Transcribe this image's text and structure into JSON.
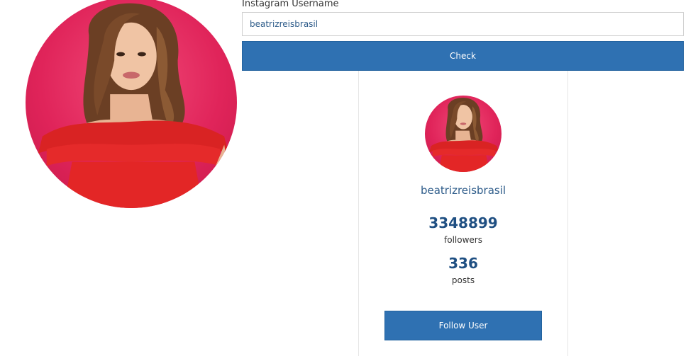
{
  "form": {
    "label": "Instagram Username",
    "username_value": "beatrizreisbrasil",
    "check_label": "Check"
  },
  "profile": {
    "username": "beatrizreisbrasil",
    "followers_count": "3348899",
    "followers_label": "followers",
    "posts_count": "336",
    "posts_label": "posts",
    "follow_label": "Follow User"
  },
  "colors": {
    "button_bg": "#2f71b2",
    "username_text": "#2e5c8a",
    "stat_text": "#1f4f82",
    "avatar_bg": "#e0245a",
    "dress": "#e52a2a"
  },
  "icons": {
    "profile_photo": "profile-photo"
  }
}
